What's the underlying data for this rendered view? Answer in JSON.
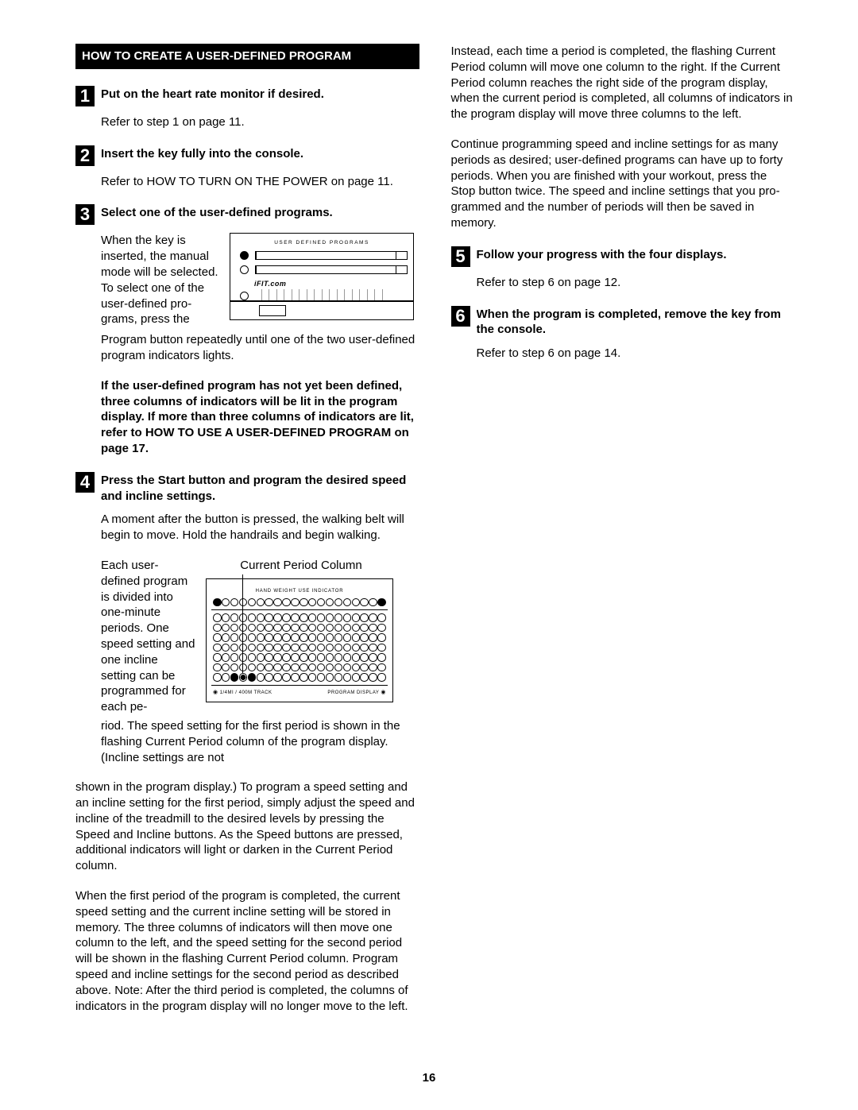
{
  "page_number": "16",
  "heading": "HOW TO CREATE A USER-DEFINED PROGRAM",
  "step1": {
    "number": "1",
    "title": "Put on the heart rate monitor if desired.",
    "body": "Refer to step 1 on page 11."
  },
  "step2": {
    "number": "2",
    "title": "Insert the key fully into the console.",
    "body": "Refer to HOW TO TURN ON THE POWER on page 11."
  },
  "step3": {
    "number": "3",
    "title": "Select one of the user-defined programs.",
    "side_text": "When the key is inserted, the manual mode will be selected. To select one of the user-defined pro­grams, press the",
    "fig_label": "USER DEFINED PROGRAMS",
    "fig_ifit": "iFIT.com",
    "after": "Program button repeatedly until one of the two user-defined program indicators lights.",
    "bold_note": "If the user-defined program has not yet been defined, three columns of indicators will be lit in the program display. If more than three columns of indicators are lit, refer to HOW TO USE A USER-DEFINED PROGRAM on page 17."
  },
  "step4": {
    "number": "4",
    "title": "Press the Start button and program the de­sired speed and incline settings.",
    "p1": "A moment after the button is pressed, the walking belt will begin to move. Hold the handrails and begin walking.",
    "side_text": "Each user-defined program is divided into one-minute periods. One speed setting and one incline setting can be programmed for each pe-",
    "fig_caption": "Current Period Column",
    "fig_top_label": "HAND WEIGHT USE INDICATOR",
    "fig_footer_left": "1/4MI / 400M TRACK",
    "fig_footer_right": "PROGRAM DISPLAY",
    "p2": "riod. The speed setting for the first period is shown in the flashing Current Period column of the program display. (Incline settings are not",
    "p3": "shown in the program display.) To program a speed setting and an incline setting for the first period, simply adjust the speed and incline of the treadmill to the desired levels by pressing the Speed and Incline buttons. As the Speed buttons are pressed, additional indicators will light or darken in the Current Period column.",
    "p4": "When the first period of the program is completed, the current speed setting and the current incline setting will be stored in memory. The three columns of indicators will then move one column to the left, and the speed setting for the second period will be shown in the flashing Current Period column. Program speed and incline settings for the second period as described above. Note: After the third period is completed, the columns of indi­cators in the program display will no longer move to the left. Instead, each time a period is com­pleted, the flashing Current Period column will move one column to the right. If the Current Period column reaches the right side of the pro­gram display, when the current period is com­pleted, all columns of indicators in the program display will move three columns to the left.",
    "p5": "Continue programming speed and incline settings for as many periods as desired; user-defined pro­grams can have up to forty periods. When you are finished with your workout, press the Stop button twice. The speed and incline settings that you pro­grammed and the number of periods will then be saved in memory."
  },
  "step5": {
    "number": "5",
    "title": "Follow your progress with the four displays.",
    "body": "Refer to step 6 on page 12."
  },
  "step6": {
    "number": "6",
    "title": "When the program is completed, remove the key from the console.",
    "body": "Refer to step 6 on page 14."
  }
}
